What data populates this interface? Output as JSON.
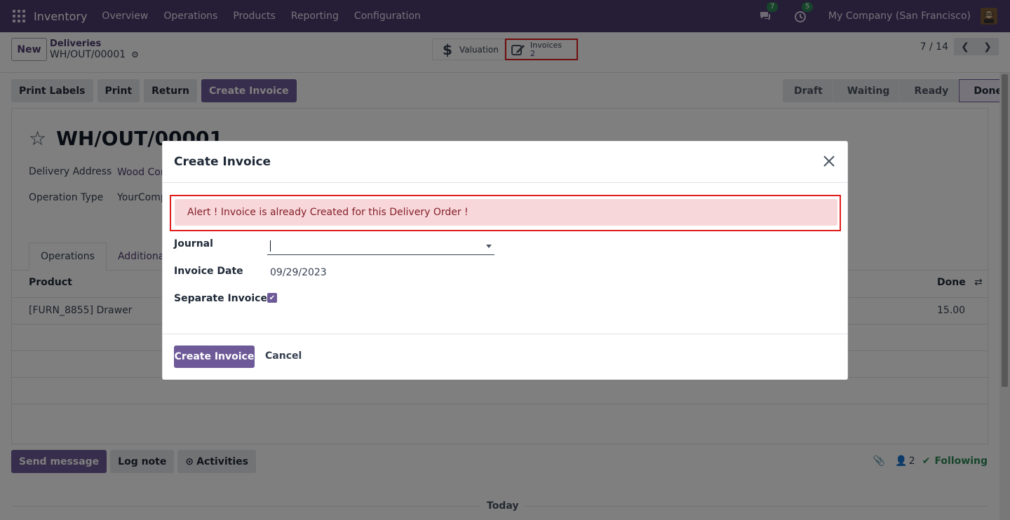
{
  "navbar": {
    "app_name": "Inventory",
    "menu": [
      "Overview",
      "Operations",
      "Products",
      "Reporting",
      "Configuration"
    ],
    "messages_count": "7",
    "activities_count": "5",
    "company": "My Company (San Francisco)"
  },
  "control_panel": {
    "new_label": "New",
    "breadcrumb_parent": "Deliveries",
    "breadcrumb_current": "WH/OUT/00001",
    "valuation_label": "Valuation",
    "invoices_label": "Invoices",
    "invoices_count": "2",
    "pager": "7 / 14"
  },
  "actions": {
    "print_labels": "Print Labels",
    "print": "Print",
    "return": "Return",
    "create_invoice": "Create Invoice"
  },
  "status": {
    "steps": [
      "Draft",
      "Waiting",
      "Ready",
      "Done"
    ],
    "current": "Done"
  },
  "record": {
    "name": "WH/OUT/00001",
    "delivery_address_label": "Delivery Address",
    "delivery_address_value": "Wood Cor",
    "operation_type_label": "Operation Type",
    "operation_type_value": "YourComp",
    "tabs": [
      "Operations",
      "Additional"
    ],
    "columns": {
      "product": "Product",
      "done": "Done"
    },
    "rows": [
      {
        "product": "[FURN_8855] Drawer",
        "done": "15.00"
      }
    ]
  },
  "chatter": {
    "send_message": "Send message",
    "log_note": "Log note",
    "activities": "Activities",
    "followers_count": "2",
    "following": "Following",
    "today": "Today"
  },
  "modal": {
    "title": "Create Invoice",
    "alert": "Alert ! Invoice is already Created for this Delivery Order !",
    "journal_label": "Journal",
    "journal_value": "",
    "invoice_date_label": "Invoice Date",
    "invoice_date_value": "09/29/2023",
    "separate_invoice_label": "Separate Invoice ?",
    "separate_invoice_checked": true,
    "create_button": "Create Invoice",
    "cancel_button": "Cancel"
  },
  "colors": {
    "navbar": "#4d3a6e",
    "primary": "#6e5a98",
    "alert_bg": "#f8d7da",
    "alert_text": "#842029",
    "highlight_border": "#e11d1d",
    "following": "#2e8b57"
  }
}
